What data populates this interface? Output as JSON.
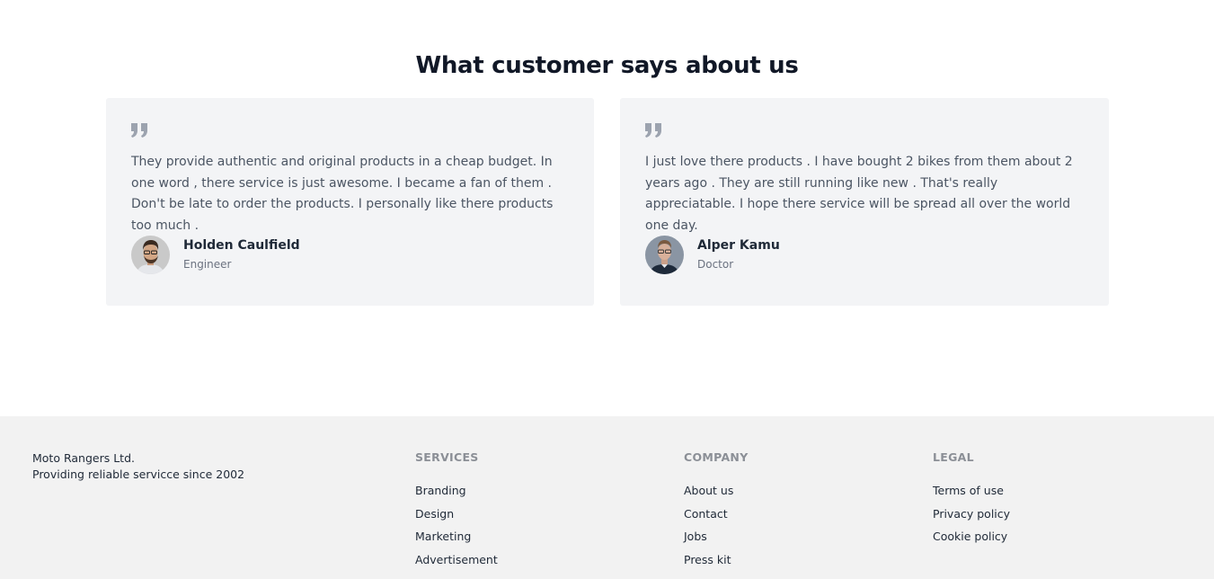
{
  "testimonials": {
    "heading": "What customer says about us",
    "items": [
      {
        "quote": "They provide authentic and original products in a cheap budget. In one word , there service is just awesome. I became a fan of them . Don't be late to order the products. I personally like there products too much .",
        "name": "Holden Caulfield",
        "role": "Engineer"
      },
      {
        "quote": "I just love there products . I have bought 2 bikes from them about 2 years ago . They are still running like new . That's really appreciatable. I hope there service will be spread all over the world one day.",
        "name": "Alper Kamu",
        "role": "Doctor"
      }
    ]
  },
  "footer": {
    "company_name": "Moto Rangers Ltd.",
    "tagline": "Providing reliable servicce since 2002",
    "services": {
      "title": "SERVICES",
      "links": [
        "Branding",
        "Design",
        "Marketing",
        "Advertisement"
      ]
    },
    "company": {
      "title": "COMPANY",
      "links": [
        "About us",
        "Contact",
        "Jobs",
        "Press kit"
      ]
    },
    "legal": {
      "title": "LEGAL",
      "links": [
        "Terms of use",
        "Privacy policy",
        "Cookie policy"
      ]
    }
  },
  "colors": {
    "card_background": "#f3f4f6",
    "footer_background": "#f2f2f2",
    "heading": "#111827",
    "muted": "#6b7280"
  }
}
